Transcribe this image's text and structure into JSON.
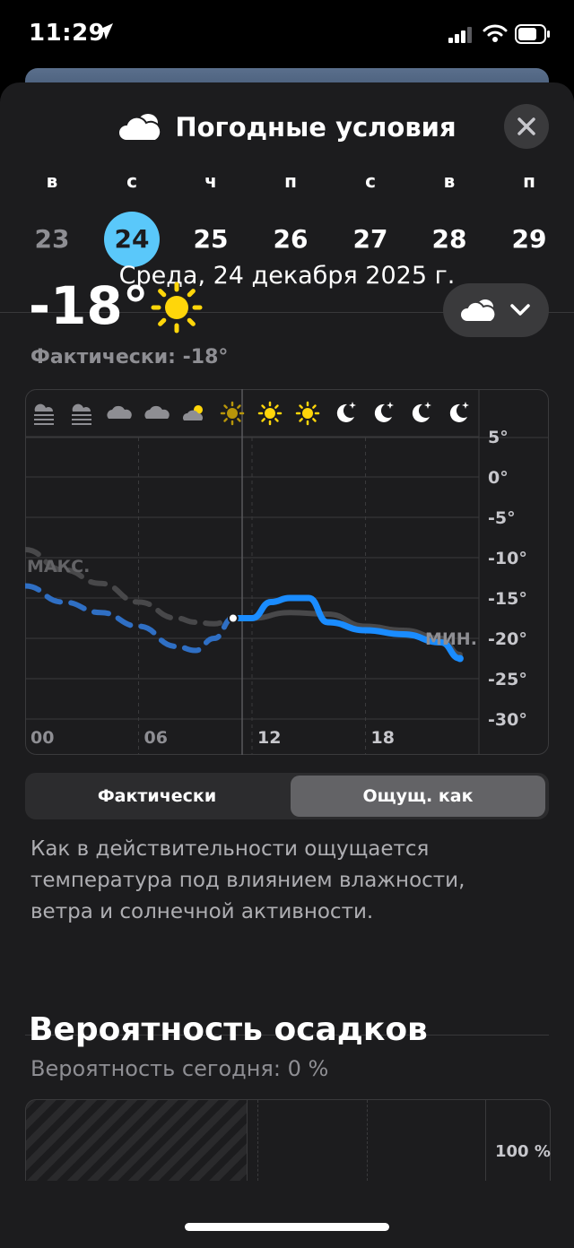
{
  "status": {
    "time": "11:29"
  },
  "header": {
    "title": "Погодные условия",
    "close_label": "×"
  },
  "days": [
    {
      "weekday": "в",
      "num": "23",
      "state": "past"
    },
    {
      "weekday": "с",
      "num": "24",
      "state": "selected"
    },
    {
      "weekday": "ч",
      "num": "25",
      "state": "future"
    },
    {
      "weekday": "п",
      "num": "26",
      "state": "future"
    },
    {
      "weekday": "с",
      "num": "27",
      "state": "future"
    },
    {
      "weekday": "в",
      "num": "28",
      "state": "future"
    },
    {
      "weekday": "п",
      "num": "29",
      "state": "future"
    }
  ],
  "date_full": "Среда, 24 декабря 2025 г.",
  "current": {
    "temp": "-18°",
    "actual": "Фактически: -18°"
  },
  "chart_data": {
    "type": "line",
    "x_ticks": [
      "00",
      "06",
      "12",
      "18"
    ],
    "y_ticks": [
      "5°",
      "0°",
      "-5°",
      "-10°",
      "-15°",
      "-20°",
      "-25°",
      "-30°"
    ],
    "ylim": [
      -30,
      5
    ],
    "hour_icons": [
      "fog",
      "fog",
      "cloud",
      "cloud",
      "partly-sunny",
      "sun",
      "sun",
      "sun",
      "moon",
      "moon",
      "moon",
      "moon"
    ],
    "labels": {
      "max": "МАКС.",
      "min": "МИН."
    },
    "series": [
      {
        "x": [
          0,
          2,
          4,
          6,
          8,
          9,
          10,
          11,
          12,
          13,
          14,
          15,
          16,
          18,
          20,
          22,
          23
        ],
        "y": [
          -13.5,
          -15.5,
          -16.8,
          -18.5,
          -21.0,
          -21.5,
          -20.0,
          -17.5,
          -17.5,
          -15.5,
          -15.0,
          -15.0,
          -18.0,
          -19.0,
          -19.5,
          -20.5,
          -22.5
        ]
      },
      {
        "x": [
          0,
          2,
          4,
          6,
          8,
          9,
          10,
          11,
          12,
          14,
          16,
          18,
          20,
          22,
          23
        ],
        "y": [
          -9.0,
          -11.5,
          -13.2,
          -15.5,
          -17.5,
          -18.0,
          -18.2,
          -17.5,
          -17.5,
          -16.8,
          -17.0,
          -18.5,
          -19.0,
          -20.0,
          -22.0
        ]
      }
    ]
  },
  "segment": {
    "left": "Фактически",
    "right": "Ощущ. как"
  },
  "description": "Как в действительности ощущается температура под влиянием влажности, ветра и солнечной активности.",
  "precip": {
    "title": "Вероятность осадков",
    "subtitle": "Вероятность сегодня: 0 %",
    "axis_label": "100 %"
  }
}
